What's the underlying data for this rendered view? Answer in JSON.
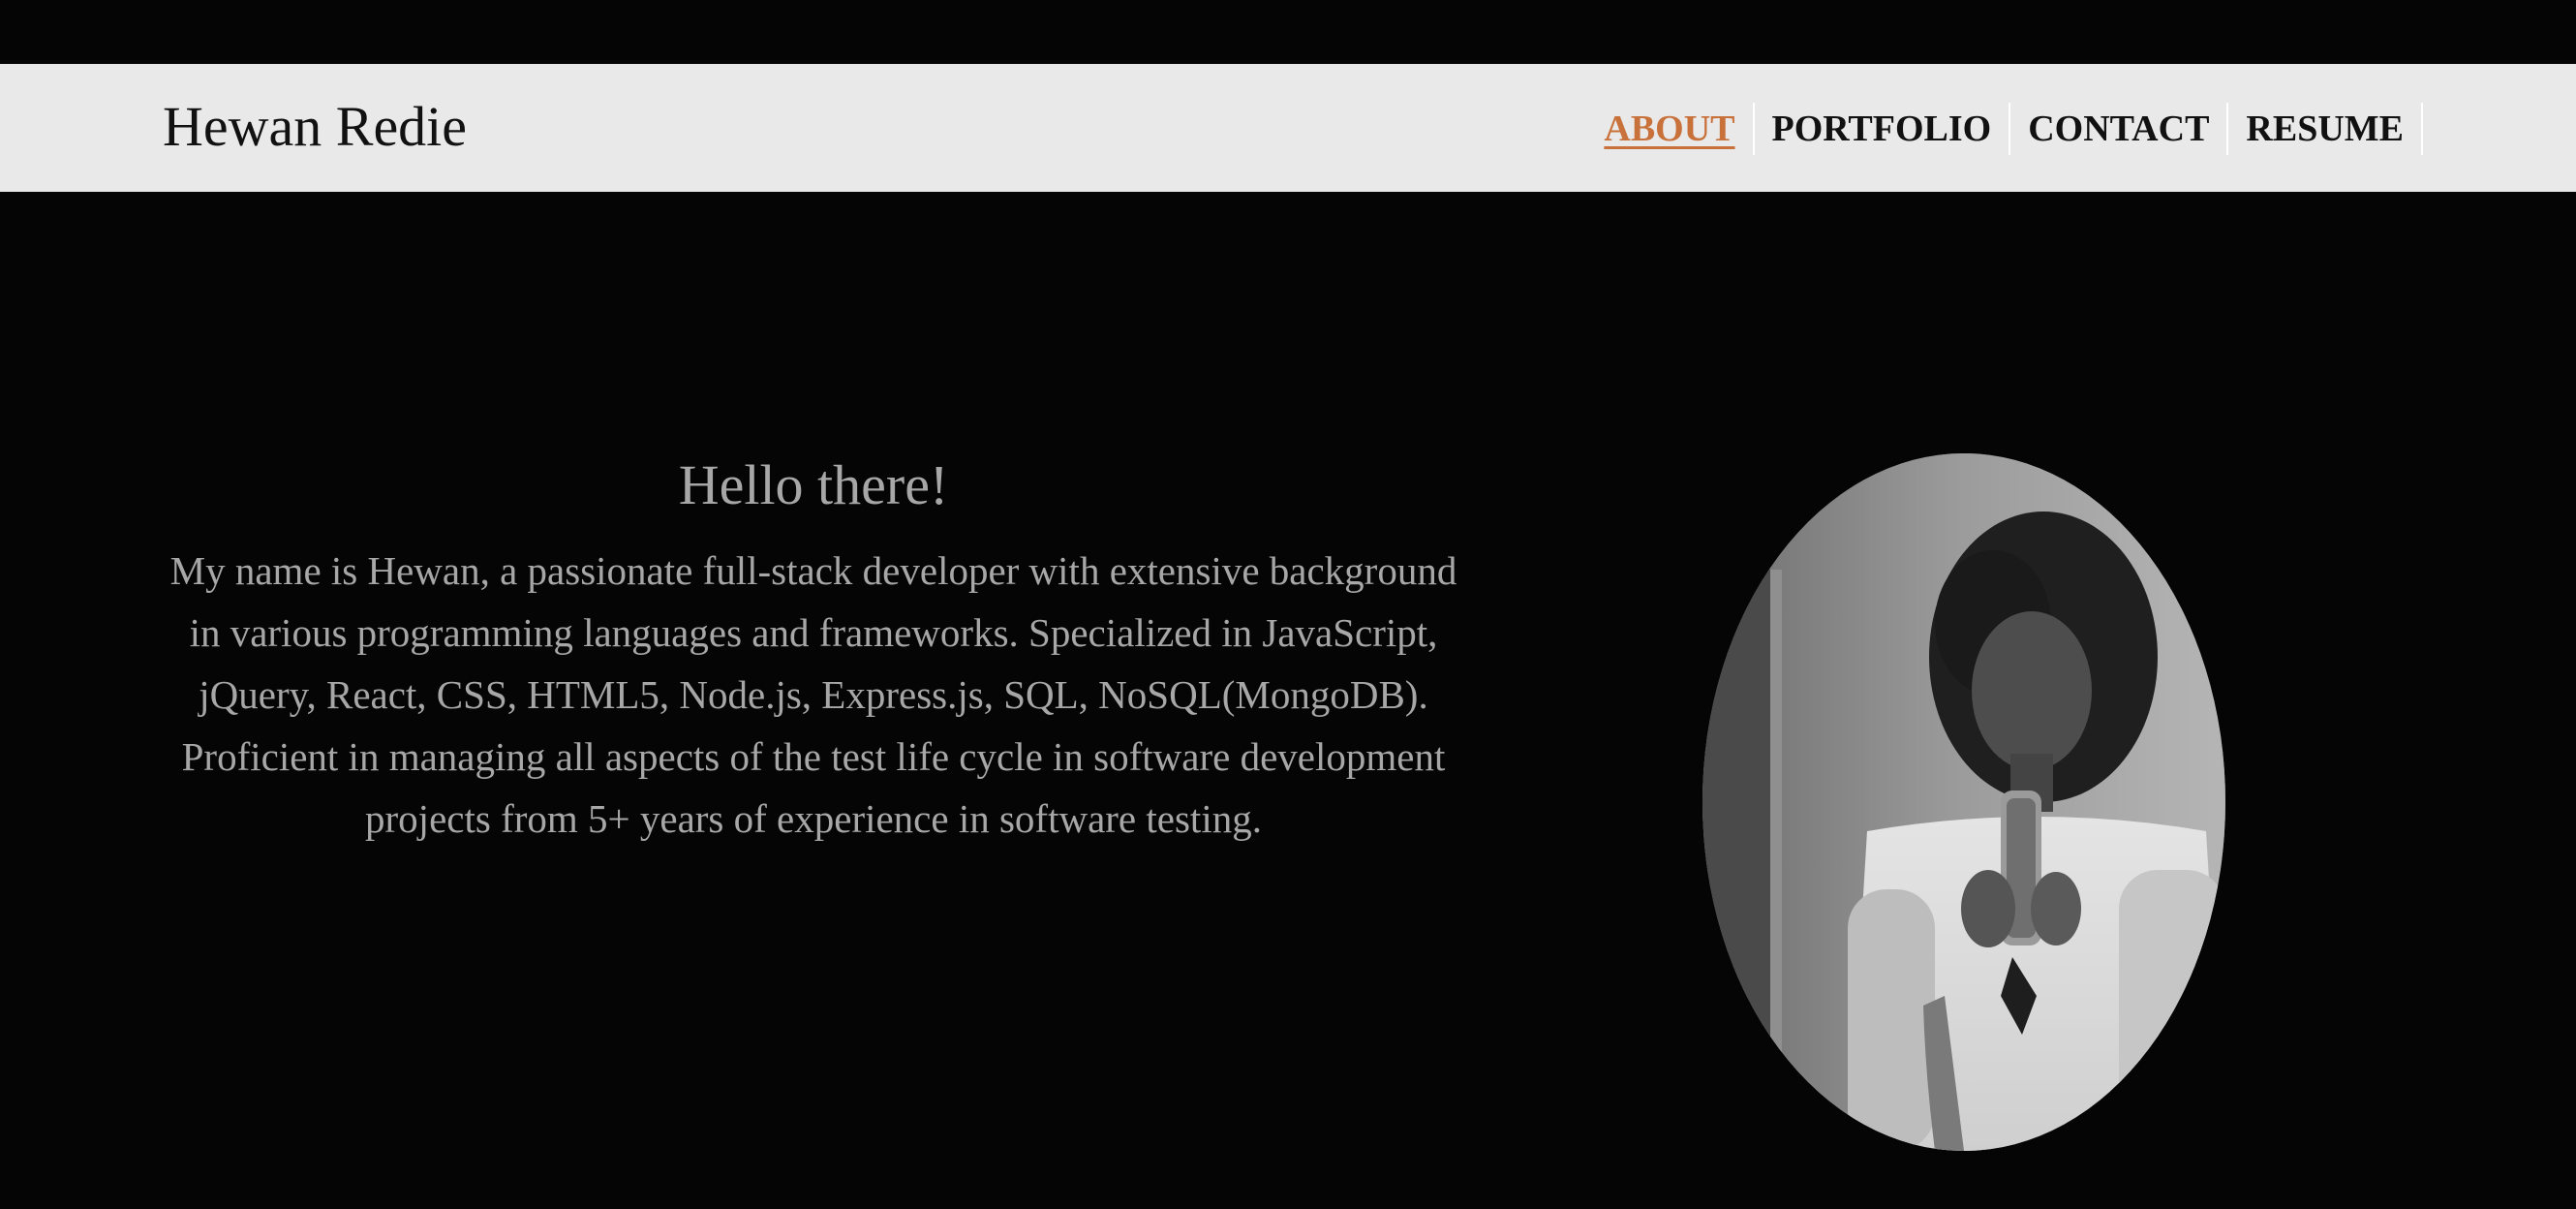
{
  "header": {
    "brand": "Hewan Redie",
    "nav": [
      {
        "label": "ABOUT",
        "active": true
      },
      {
        "label": "PORTFOLIO",
        "active": false
      },
      {
        "label": "CONTACT",
        "active": false
      },
      {
        "label": "RESUME",
        "active": false
      }
    ]
  },
  "about": {
    "title": "Hello there!",
    "text": "My name is Hewan, a passionate full-stack developer with extensive background in various programming languages and frameworks. Specialized in JavaScript, jQuery, React, CSS, HTML5, Node.js, Express.js, SQL, NoSQL(MongoDB). Proficient in managing all aspects of the test life cycle in software development projects from 5+ years of experience in software testing."
  },
  "colors": {
    "background": "#050505",
    "navbar": "#e9e9e9",
    "accent": "#c8713a",
    "text": "#a7a7a7"
  },
  "icons": {
    "portrait": "profile-photo"
  }
}
